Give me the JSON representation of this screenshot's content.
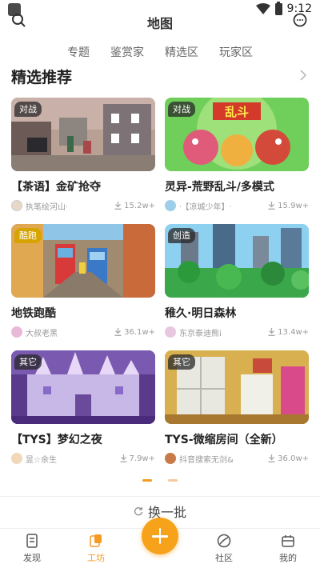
{
  "status_bar": {
    "time": "9:12"
  },
  "top_bar": {
    "title": "地图"
  },
  "sub_tabs": [
    "专题",
    "鉴赏家",
    "精选区",
    "玩家区"
  ],
  "section": {
    "title": "精选推荐"
  },
  "cards": [
    {
      "tag": "对战",
      "title": "【茶语】金矿抢夺",
      "author": "执笔绘河山ᐧ",
      "downloads": "15.2w+"
    },
    {
      "tag": "对战",
      "title": "灵异-荒野乱斗/多模式",
      "author": "ᐧ【凉城少年】ᐧ",
      "downloads": "15.9w+"
    },
    {
      "tag": "酷跑",
      "title": "地铁跑酷",
      "author": "大叔老黑",
      "downloads": "36.1w+"
    },
    {
      "tag": "创造",
      "title": "稚久·明日森林",
      "author": "东京泰迪熊i",
      "downloads": "13.4w+"
    },
    {
      "tag": "其它",
      "title": "【TYS】梦幻之夜",
      "author": "昱☆余生",
      "downloads": "7.9w+"
    },
    {
      "tag": "其它",
      "title": "TYS-微缩房间（全新）",
      "author": "抖音搜索无剑&",
      "downloads": "36.0w+"
    }
  ],
  "refresh_label": "换一批",
  "tabbar": {
    "discover": "发现",
    "workshop": "工坊",
    "community": "社区",
    "mine": "我的"
  },
  "colors": {
    "accent": "#f59a23"
  }
}
